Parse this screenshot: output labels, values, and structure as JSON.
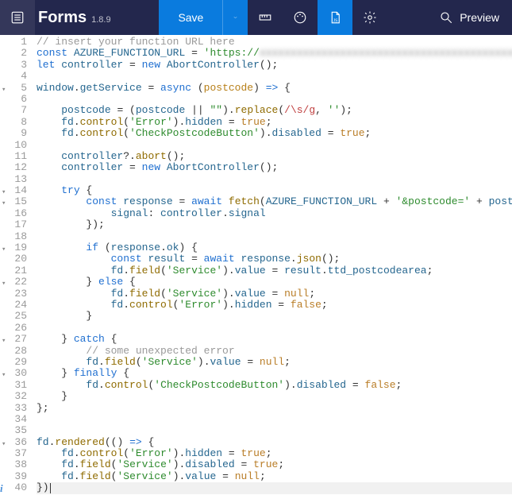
{
  "header": {
    "app_name": "Forms",
    "version": "1.8.9",
    "save_label": "Save",
    "preview_label": "Preview"
  },
  "editor": {
    "current_line": 40,
    "lines": [
      {
        "n": 1,
        "fold": false,
        "tokens": [
          [
            "cmt",
            "// insert your function URL here"
          ]
        ]
      },
      {
        "n": 2,
        "fold": false,
        "tokens": [
          [
            "kw",
            "const"
          ],
          [
            "op",
            " "
          ],
          [
            "var",
            "AZURE_FUNCTION_URL"
          ],
          [
            "op",
            " = "
          ],
          [
            "str",
            "'https://"
          ],
          [
            "blur",
            "xxxxxxxxxxxxxxxxxxxxxxxxxxxxxxxxxxxxxxxxxxxxxxx"
          ]
        ]
      },
      {
        "n": 3,
        "fold": false,
        "tokens": [
          [
            "kw",
            "let"
          ],
          [
            "op",
            " "
          ],
          [
            "var",
            "controller"
          ],
          [
            "op",
            " = "
          ],
          [
            "kw",
            "new"
          ],
          [
            "op",
            " "
          ],
          [
            "var",
            "AbortController"
          ],
          [
            "op",
            "();"
          ]
        ]
      },
      {
        "n": 4,
        "fold": false,
        "tokens": []
      },
      {
        "n": 5,
        "fold": true,
        "tokens": [
          [
            "var",
            "window"
          ],
          [
            "op",
            "."
          ],
          [
            "var",
            "getService"
          ],
          [
            "op",
            " = "
          ],
          [
            "kw",
            "async"
          ],
          [
            "op",
            " ("
          ],
          [
            "par",
            "postcode"
          ],
          [
            "op",
            ") "
          ],
          [
            "kw",
            "=>"
          ],
          [
            "op",
            " {"
          ]
        ]
      },
      {
        "n": 6,
        "fold": false,
        "tokens": []
      },
      {
        "n": 7,
        "fold": false,
        "tokens": [
          [
            "op",
            "    "
          ],
          [
            "var",
            "postcode"
          ],
          [
            "op",
            " = ("
          ],
          [
            "var",
            "postcode"
          ],
          [
            "op",
            " || "
          ],
          [
            "str",
            "\"\""
          ],
          [
            "op",
            ")."
          ],
          [
            "fn",
            "replace"
          ],
          [
            "op",
            "("
          ],
          [
            "re",
            "/\\s/g"
          ],
          [
            "op",
            ", "
          ],
          [
            "str",
            "''"
          ],
          [
            "op",
            ");"
          ]
        ]
      },
      {
        "n": 8,
        "fold": false,
        "tokens": [
          [
            "op",
            "    "
          ],
          [
            "var",
            "fd"
          ],
          [
            "op",
            "."
          ],
          [
            "fn",
            "control"
          ],
          [
            "op",
            "("
          ],
          [
            "str",
            "'Error'"
          ],
          [
            "op",
            ")."
          ],
          [
            "var",
            "hidden"
          ],
          [
            "op",
            " = "
          ],
          [
            "lit",
            "true"
          ],
          [
            "op",
            ";"
          ]
        ]
      },
      {
        "n": 9,
        "fold": false,
        "tokens": [
          [
            "op",
            "    "
          ],
          [
            "var",
            "fd"
          ],
          [
            "op",
            "."
          ],
          [
            "fn",
            "control"
          ],
          [
            "op",
            "("
          ],
          [
            "str",
            "'CheckPostcodeButton'"
          ],
          [
            "op",
            ")."
          ],
          [
            "var",
            "disabled"
          ],
          [
            "op",
            " = "
          ],
          [
            "lit",
            "true"
          ],
          [
            "op",
            ";"
          ]
        ]
      },
      {
        "n": 10,
        "fold": false,
        "tokens": []
      },
      {
        "n": 11,
        "fold": false,
        "tokens": [
          [
            "op",
            "    "
          ],
          [
            "var",
            "controller"
          ],
          [
            "op",
            "?."
          ],
          [
            "fn",
            "abort"
          ],
          [
            "op",
            "();"
          ]
        ]
      },
      {
        "n": 12,
        "fold": false,
        "tokens": [
          [
            "op",
            "    "
          ],
          [
            "var",
            "controller"
          ],
          [
            "op",
            " = "
          ],
          [
            "kw",
            "new"
          ],
          [
            "op",
            " "
          ],
          [
            "var",
            "AbortController"
          ],
          [
            "op",
            "();"
          ]
        ]
      },
      {
        "n": 13,
        "fold": false,
        "tokens": []
      },
      {
        "n": 14,
        "fold": true,
        "tokens": [
          [
            "op",
            "    "
          ],
          [
            "kw",
            "try"
          ],
          [
            "op",
            " {"
          ]
        ]
      },
      {
        "n": 15,
        "fold": true,
        "tokens": [
          [
            "op",
            "        "
          ],
          [
            "kw",
            "const"
          ],
          [
            "op",
            " "
          ],
          [
            "var",
            "response"
          ],
          [
            "op",
            " = "
          ],
          [
            "kw",
            "await"
          ],
          [
            "op",
            " "
          ],
          [
            "fn",
            "fetch"
          ],
          [
            "op",
            "("
          ],
          [
            "var",
            "AZURE_FUNCTION_URL"
          ],
          [
            "op",
            " + "
          ],
          [
            "str",
            "'&postcode='"
          ],
          [
            "op",
            " + "
          ],
          [
            "var",
            "postcode"
          ],
          [
            "op",
            ", {"
          ]
        ]
      },
      {
        "n": 16,
        "fold": false,
        "tokens": [
          [
            "op",
            "            "
          ],
          [
            "var",
            "signal"
          ],
          [
            "op",
            ": "
          ],
          [
            "var",
            "controller"
          ],
          [
            "op",
            "."
          ],
          [
            "var",
            "signal"
          ]
        ]
      },
      {
        "n": 17,
        "fold": false,
        "tokens": [
          [
            "op",
            "        });"
          ]
        ]
      },
      {
        "n": 18,
        "fold": false,
        "tokens": []
      },
      {
        "n": 19,
        "fold": true,
        "tokens": [
          [
            "op",
            "        "
          ],
          [
            "kw",
            "if"
          ],
          [
            "op",
            " ("
          ],
          [
            "var",
            "response"
          ],
          [
            "op",
            "."
          ],
          [
            "var",
            "ok"
          ],
          [
            "op",
            ") {"
          ]
        ]
      },
      {
        "n": 20,
        "fold": false,
        "tokens": [
          [
            "op",
            "            "
          ],
          [
            "kw",
            "const"
          ],
          [
            "op",
            " "
          ],
          [
            "var",
            "result"
          ],
          [
            "op",
            " = "
          ],
          [
            "kw",
            "await"
          ],
          [
            "op",
            " "
          ],
          [
            "var",
            "response"
          ],
          [
            "op",
            "."
          ],
          [
            "fn",
            "json"
          ],
          [
            "op",
            "();"
          ]
        ]
      },
      {
        "n": 21,
        "fold": false,
        "tokens": [
          [
            "op",
            "            "
          ],
          [
            "var",
            "fd"
          ],
          [
            "op",
            "."
          ],
          [
            "fn",
            "field"
          ],
          [
            "op",
            "("
          ],
          [
            "str",
            "'Service'"
          ],
          [
            "op",
            ")."
          ],
          [
            "var",
            "value"
          ],
          [
            "op",
            " = "
          ],
          [
            "var",
            "result"
          ],
          [
            "op",
            "."
          ],
          [
            "var",
            "ttd_postcodearea"
          ],
          [
            "op",
            ";"
          ]
        ]
      },
      {
        "n": 22,
        "fold": true,
        "tokens": [
          [
            "op",
            "        } "
          ],
          [
            "kw",
            "else"
          ],
          [
            "op",
            " {"
          ]
        ]
      },
      {
        "n": 23,
        "fold": false,
        "tokens": [
          [
            "op",
            "            "
          ],
          [
            "var",
            "fd"
          ],
          [
            "op",
            "."
          ],
          [
            "fn",
            "field"
          ],
          [
            "op",
            "("
          ],
          [
            "str",
            "'Service'"
          ],
          [
            "op",
            ")."
          ],
          [
            "var",
            "value"
          ],
          [
            "op",
            " = "
          ],
          [
            "lit",
            "null"
          ],
          [
            "op",
            ";"
          ]
        ]
      },
      {
        "n": 24,
        "fold": false,
        "tokens": [
          [
            "op",
            "            "
          ],
          [
            "var",
            "fd"
          ],
          [
            "op",
            "."
          ],
          [
            "fn",
            "control"
          ],
          [
            "op",
            "("
          ],
          [
            "str",
            "'Error'"
          ],
          [
            "op",
            ")."
          ],
          [
            "var",
            "hidden"
          ],
          [
            "op",
            " = "
          ],
          [
            "lit",
            "false"
          ],
          [
            "op",
            ";"
          ]
        ]
      },
      {
        "n": 25,
        "fold": false,
        "tokens": [
          [
            "op",
            "        }"
          ]
        ]
      },
      {
        "n": 26,
        "fold": false,
        "tokens": []
      },
      {
        "n": 27,
        "fold": true,
        "tokens": [
          [
            "op",
            "    } "
          ],
          [
            "kw",
            "catch"
          ],
          [
            "op",
            " {"
          ]
        ]
      },
      {
        "n": 28,
        "fold": false,
        "tokens": [
          [
            "op",
            "        "
          ],
          [
            "cmt",
            "// some unexpected error"
          ]
        ]
      },
      {
        "n": 29,
        "fold": false,
        "tokens": [
          [
            "op",
            "        "
          ],
          [
            "var",
            "fd"
          ],
          [
            "op",
            "."
          ],
          [
            "fn",
            "field"
          ],
          [
            "op",
            "("
          ],
          [
            "str",
            "'Service'"
          ],
          [
            "op",
            ")."
          ],
          [
            "var",
            "value"
          ],
          [
            "op",
            " = "
          ],
          [
            "lit",
            "null"
          ],
          [
            "op",
            ";"
          ]
        ]
      },
      {
        "n": 30,
        "fold": true,
        "tokens": [
          [
            "op",
            "    } "
          ],
          [
            "kw",
            "finally"
          ],
          [
            "op",
            " {"
          ]
        ]
      },
      {
        "n": 31,
        "fold": false,
        "tokens": [
          [
            "op",
            "        "
          ],
          [
            "var",
            "fd"
          ],
          [
            "op",
            "."
          ],
          [
            "fn",
            "control"
          ],
          [
            "op",
            "("
          ],
          [
            "str",
            "'CheckPostcodeButton'"
          ],
          [
            "op",
            ")."
          ],
          [
            "var",
            "disabled"
          ],
          [
            "op",
            " = "
          ],
          [
            "lit",
            "false"
          ],
          [
            "op",
            ";"
          ]
        ]
      },
      {
        "n": 32,
        "fold": false,
        "tokens": [
          [
            "op",
            "    }"
          ]
        ]
      },
      {
        "n": 33,
        "fold": false,
        "tokens": [
          [
            "op",
            "};"
          ]
        ]
      },
      {
        "n": 34,
        "fold": false,
        "tokens": []
      },
      {
        "n": 35,
        "fold": false,
        "tokens": []
      },
      {
        "n": 36,
        "fold": true,
        "tokens": [
          [
            "var",
            "fd"
          ],
          [
            "op",
            "."
          ],
          [
            "fn",
            "rendered"
          ],
          [
            "op",
            "(() "
          ],
          [
            "kw",
            "=>"
          ],
          [
            "op",
            " {"
          ]
        ]
      },
      {
        "n": 37,
        "fold": false,
        "tokens": [
          [
            "op",
            "    "
          ],
          [
            "var",
            "fd"
          ],
          [
            "op",
            "."
          ],
          [
            "fn",
            "control"
          ],
          [
            "op",
            "("
          ],
          [
            "str",
            "'Error'"
          ],
          [
            "op",
            ")."
          ],
          [
            "var",
            "hidden"
          ],
          [
            "op",
            " = "
          ],
          [
            "lit",
            "true"
          ],
          [
            "op",
            ";"
          ]
        ]
      },
      {
        "n": 38,
        "fold": false,
        "tokens": [
          [
            "op",
            "    "
          ],
          [
            "var",
            "fd"
          ],
          [
            "op",
            "."
          ],
          [
            "fn",
            "field"
          ],
          [
            "op",
            "("
          ],
          [
            "str",
            "'Service'"
          ],
          [
            "op",
            ")."
          ],
          [
            "var",
            "disabled"
          ],
          [
            "op",
            " = "
          ],
          [
            "lit",
            "true"
          ],
          [
            "op",
            ";"
          ]
        ]
      },
      {
        "n": 39,
        "fold": false,
        "tokens": [
          [
            "op",
            "    "
          ],
          [
            "var",
            "fd"
          ],
          [
            "op",
            "."
          ],
          [
            "fn",
            "field"
          ],
          [
            "op",
            "("
          ],
          [
            "str",
            "'Service'"
          ],
          [
            "op",
            ")."
          ],
          [
            "var",
            "value"
          ],
          [
            "op",
            " = "
          ],
          [
            "lit",
            "null"
          ],
          [
            "op",
            ";"
          ]
        ]
      },
      {
        "n": 40,
        "fold": false,
        "info": true,
        "hl": true,
        "cursor": true,
        "tokens": [
          [
            "op",
            "})"
          ]
        ]
      }
    ]
  }
}
